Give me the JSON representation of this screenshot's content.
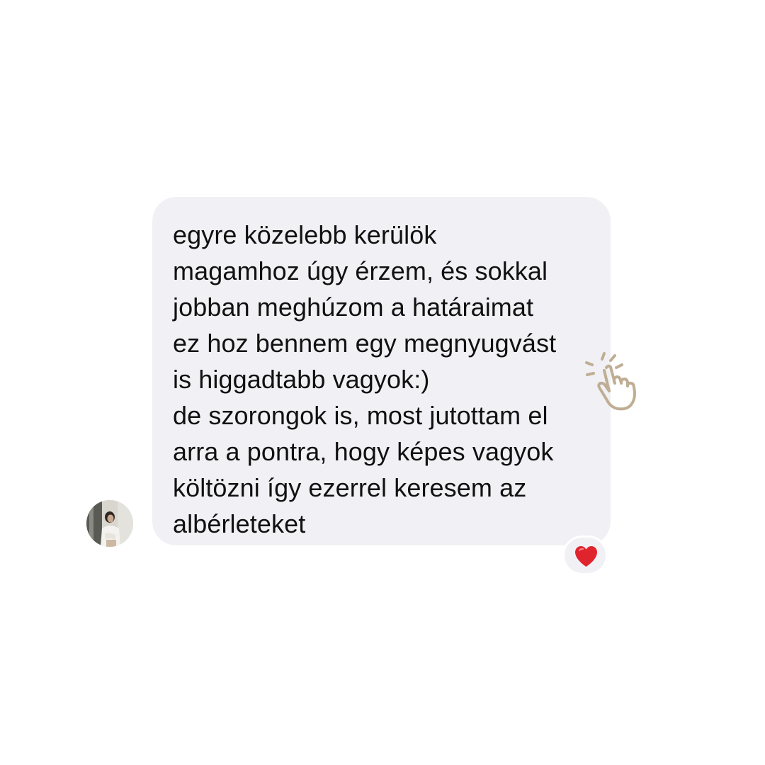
{
  "message": {
    "lines": [
      "egyre közelebb kerülök",
      "magamhoz úgy érzem, és sokkal",
      "jobban meghúzom a határaimat",
      "ez hoz bennem egy megnyugvást",
      "is higgadtabb vagyok:)",
      "de szorongok is, most jutottam el",
      "arra a pontra, hogy képes vagyok",
      "költözni így ezerrel keresem az",
      "albérleteket"
    ],
    "bubble_color": "#f1f1f5",
    "text_color": "#111111"
  },
  "reaction": {
    "icon": "red-heart-icon",
    "color": "#e0242e"
  },
  "decoration": {
    "icon": "pointing-hand-tap-icon",
    "color": "#bfae94"
  },
  "avatar": {
    "icon": "profile-photo"
  }
}
